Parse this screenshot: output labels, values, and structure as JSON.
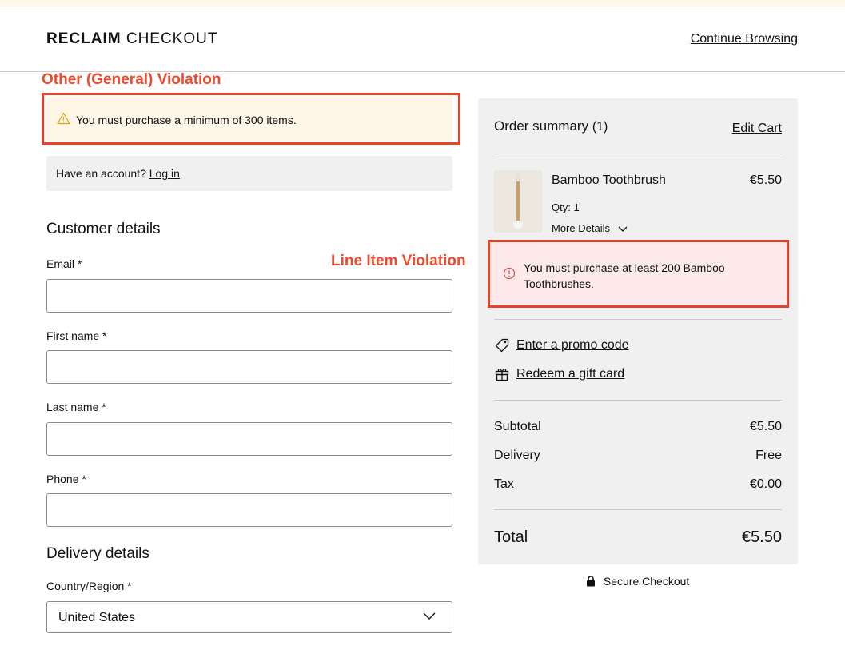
{
  "header": {
    "brand_bold": "RECLAIM",
    "brand_light": "CHECKOUT",
    "continue_label": "Continue Browsing"
  },
  "annotations": {
    "general": "Other (General) Violation",
    "line_item": "Line Item Violation",
    "color": "#e7412a"
  },
  "general_warning": {
    "icon": "warning-triangle-icon",
    "text": "You must purchase a minimum of 300 items."
  },
  "account": {
    "prompt": "Have an account?",
    "login_label": "Log in"
  },
  "customer": {
    "title": "Customer details",
    "fields": [
      {
        "label": "Email *",
        "value": ""
      },
      {
        "label": "First name *",
        "value": ""
      },
      {
        "label": "Last name *",
        "value": ""
      },
      {
        "label": "Phone *",
        "value": ""
      }
    ]
  },
  "delivery": {
    "title": "Delivery details",
    "country_label": "Country/Region *",
    "country_value": "United States"
  },
  "summary": {
    "title": "Order summary",
    "count": "(1)",
    "edit_cart": "Edit Cart",
    "item": {
      "name": "Bamboo Toothbrush",
      "price": "€5.50",
      "qty": "Qty: 1",
      "more_details": "More Details"
    },
    "line_error": {
      "icon": "error-circle-icon",
      "text": "You must purchase at least 200 Bamboo Toothbrushes."
    },
    "promo_label": "Enter a promo code",
    "gift_label": "Redeem a gift card",
    "subtotal_label": "Subtotal",
    "subtotal_value": "€5.50",
    "delivery_label": "Delivery",
    "delivery_value": "Free",
    "tax_label": "Tax",
    "tax_value": "€0.00",
    "total_label": "Total",
    "total_value": "€5.50"
  },
  "secure_label": "Secure Checkout"
}
